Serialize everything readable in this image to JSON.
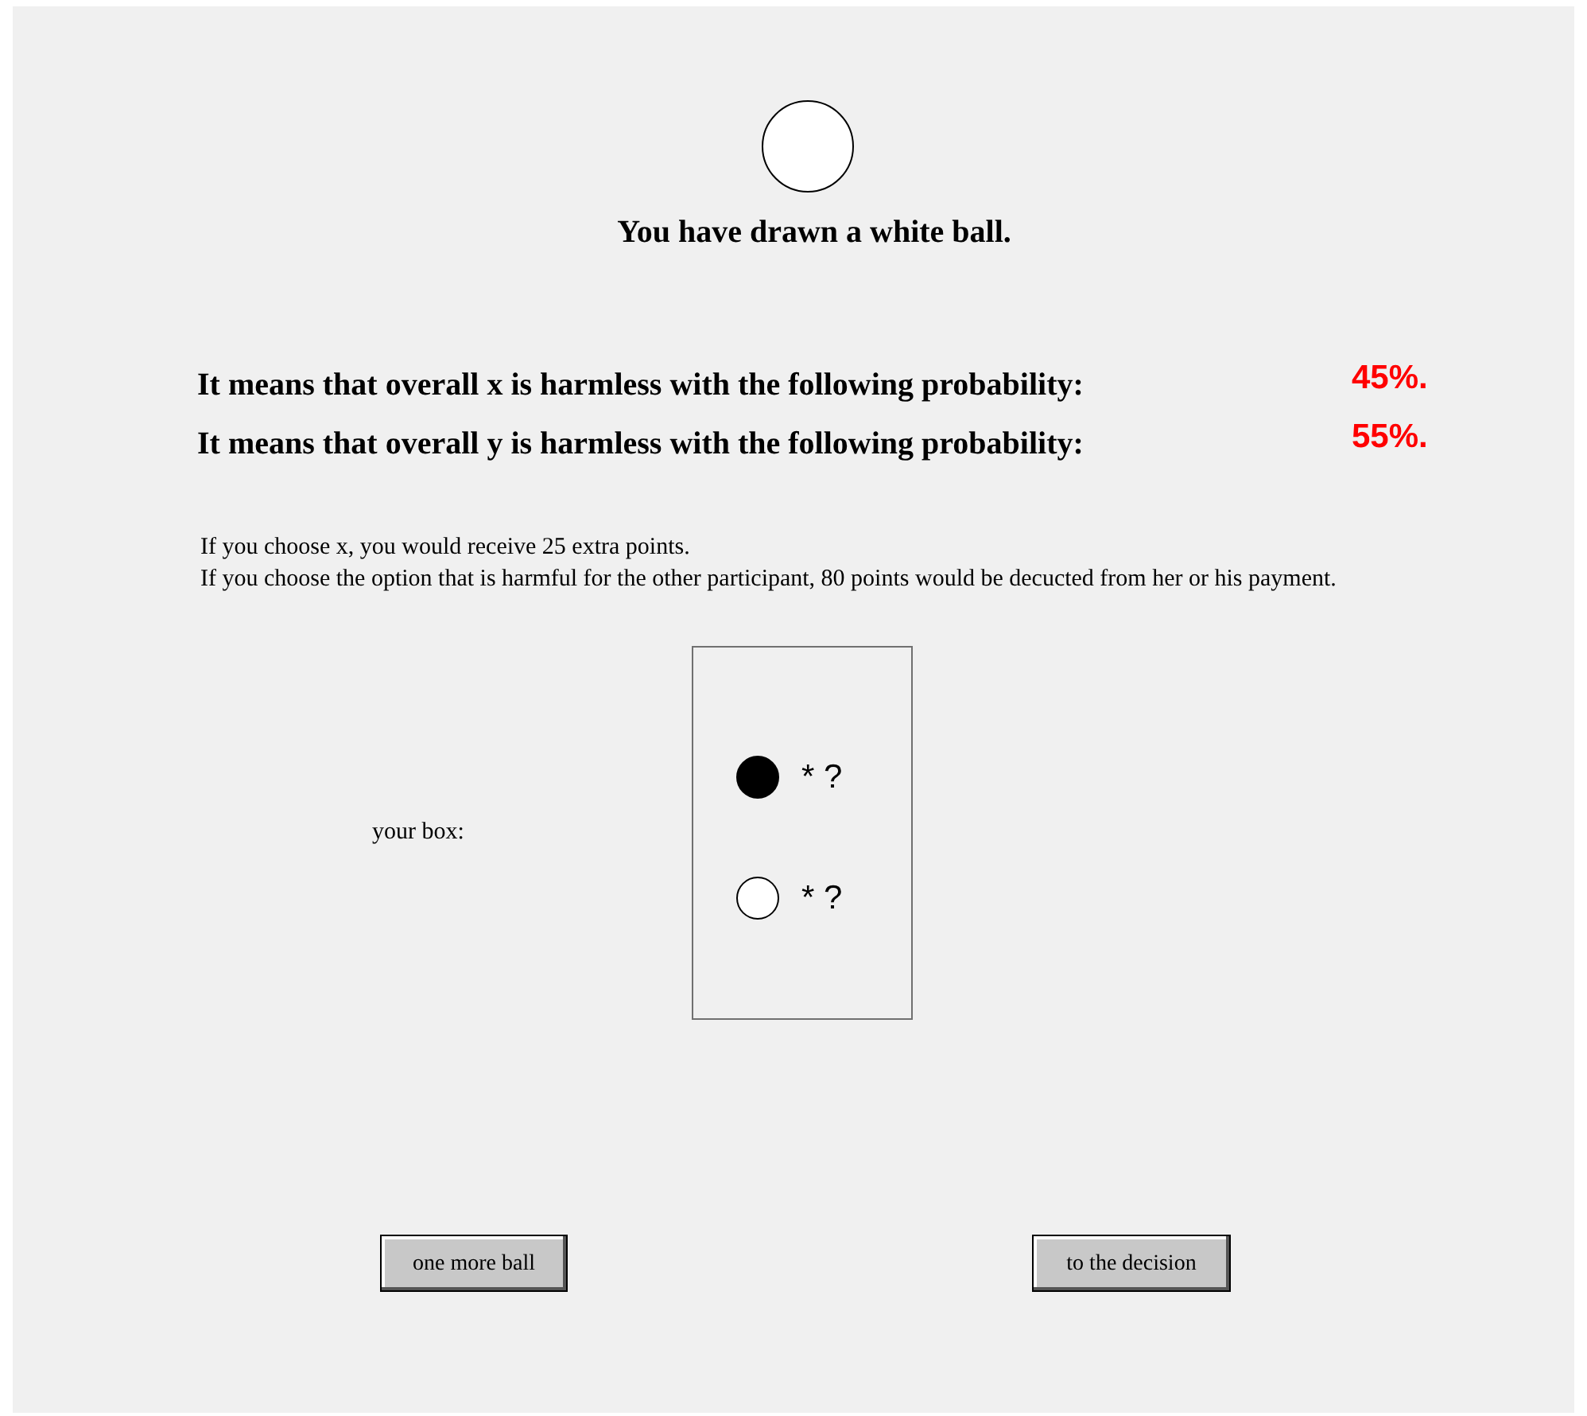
{
  "drawn_ball": {
    "color": "#ffffff"
  },
  "heading": "You have drawn a white ball.",
  "probabilities": [
    {
      "label": "It means that overall x is harmless with the following probability:",
      "value": "45%."
    },
    {
      "label": "It means that overall y is harmless with the following probability:",
      "value": "55%."
    }
  ],
  "info": [
    "If you choose x, you would receive 25 extra points.",
    "If you choose the option that is harmful for the other participant, 80 points would be decucted from her or his payment."
  ],
  "box": {
    "label": "your box:",
    "balls": [
      {
        "color": "#000000",
        "text": "* ?"
      },
      {
        "color": "#ffffff",
        "text": "* ?"
      }
    ]
  },
  "buttons": [
    "one more ball",
    "to the decision"
  ]
}
